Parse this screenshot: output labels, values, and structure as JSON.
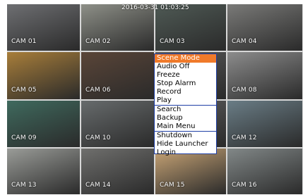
{
  "timestamp": "2016-03-31 01:03:25",
  "cameras": [
    {
      "label": "CAM 01",
      "bg": "#6e6f72"
    },
    {
      "label": "CAM 02",
      "bg": "#8e9088"
    },
    {
      "label": "CAM 03",
      "bg": "#4f5a55"
    },
    {
      "label": "CAM 04",
      "bg": "#7a7a78"
    },
    {
      "label": "CAM 05",
      "bg": "#a87e3a"
    },
    {
      "label": "CAM 06",
      "bg": "#5a4538"
    },
    {
      "label": "",
      "bg": "#5a5a5a"
    },
    {
      "label": "CAM 08",
      "bg": "#8c8c8c"
    },
    {
      "label": "CAM 09",
      "bg": "#3f6a5e"
    },
    {
      "label": "CAM 10",
      "bg": "#676b6c"
    },
    {
      "label": "",
      "bg": "#5e5e5e"
    },
    {
      "label": "CAM 12",
      "bg": "#6a7d86"
    },
    {
      "label": "CAM 13",
      "bg": "#9a9c98"
    },
    {
      "label": "CAM 14",
      "bg": "#6f6f6d"
    },
    {
      "label": "CAM 15",
      "bg": "#c9a576"
    },
    {
      "label": "CAM 16",
      "bg": "#828888"
    }
  ],
  "menu": {
    "items": [
      {
        "label": "Scene Mode",
        "selected": true
      },
      {
        "label": "Audio Off"
      },
      {
        "label": "Freeze"
      },
      {
        "label": "Stop Alarm"
      },
      {
        "label": "Record"
      },
      {
        "label": "Play"
      },
      {
        "label": "Search"
      },
      {
        "label": "Backup"
      },
      {
        "label": "Main Menu"
      },
      {
        "label": "Shutdown"
      },
      {
        "label": "Hide Launcher"
      },
      {
        "label": "Login"
      }
    ]
  },
  "colors": {
    "menu_highlight": "#f07a2a",
    "menu_border": "#1f3fa6"
  }
}
